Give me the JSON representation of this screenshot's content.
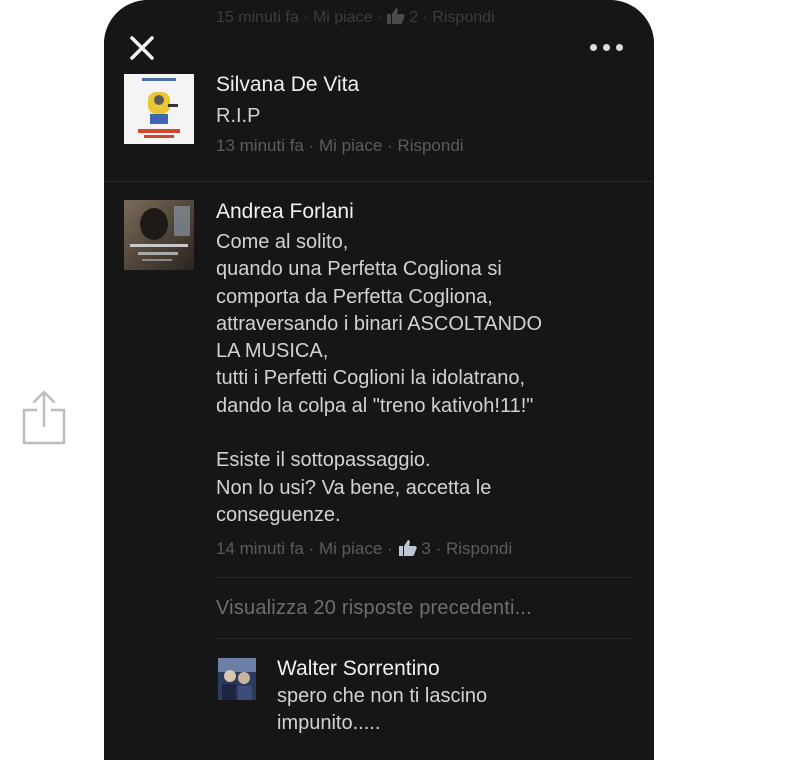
{
  "colors": {
    "phone_background": "#161616",
    "author_text": "#f0f0f0",
    "body_text": "#d2d2d2",
    "meta_text": "#5c5c5c"
  },
  "share_icon": "share-icon",
  "top_bar": {
    "close_icon": "close-icon",
    "more_icon": "more-dots-icon",
    "partial_meta": {
      "time": "15 minuti fa",
      "sep": " · ",
      "like_action": "Mi piace",
      "likes": "2",
      "reply_action": "Rispondi"
    }
  },
  "comments": [
    {
      "author": "Silvana De Vita",
      "text": "R.I.P",
      "time": "13 minuti fa",
      "sep": " · ",
      "like_action": "Mi piace",
      "reply_action": "Rispondi"
    },
    {
      "author": "Andrea Forlani",
      "text": "Come al solito,\nquando una Perfetta Cogliona si\ncomporta da Perfetta Cogliona,\nattraversando i binari ASCOLTANDO\nLA MUSICA,\ntutti i Perfetti Coglioni la idolatrano,\ndando la colpa al \"treno kativoh!11!\"\n\nEsiste il sottopassaggio.\nNon lo usi? Va bene, accetta le\nconseguenze.",
      "time": "14 minuti fa",
      "sep": " · ",
      "like_action": "Mi piace",
      "likes": "3",
      "reply_action": "Rispondi"
    }
  ],
  "view_previous_replies": "Visualizza 20 risposte precedenti...",
  "reply": {
    "author": "Walter Sorrentino",
    "text": "spero che non ti lascino\nimpunito....."
  }
}
